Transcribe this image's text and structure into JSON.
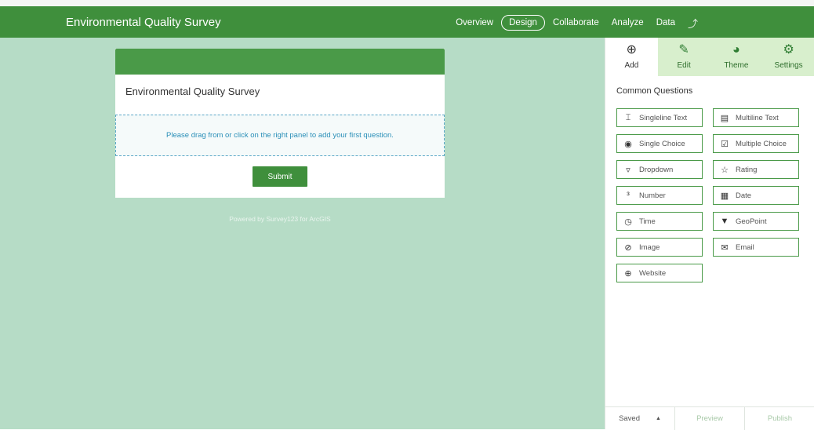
{
  "header": {
    "title": "Environmental Quality Survey",
    "nav": [
      "Overview",
      "Design",
      "Collaborate",
      "Analyze",
      "Data"
    ],
    "active_nav": "Design"
  },
  "form": {
    "title": "Environmental Quality Survey",
    "placeholder": "Please drag from or click on the right panel to add your first question.",
    "submit_label": "Submit",
    "powered_by": "Powered by Survey123 for ArcGIS"
  },
  "panel": {
    "tabs": [
      {
        "label": "Add",
        "icon": "add-circle-icon"
      },
      {
        "label": "Edit",
        "icon": "pencil-icon"
      },
      {
        "label": "Theme",
        "icon": "palette-icon"
      },
      {
        "label": "Settings",
        "icon": "settings-icon"
      }
    ],
    "section_title": "Common Questions",
    "questions": [
      {
        "label": "Singleline Text",
        "icon": "text-cursor-icon"
      },
      {
        "label": "Multiline Text",
        "icon": "text-area-icon"
      },
      {
        "label": "Single Choice",
        "icon": "radio-icon"
      },
      {
        "label": "Multiple Choice",
        "icon": "checkbox-icon"
      },
      {
        "label": "Dropdown",
        "icon": "dropdown-icon"
      },
      {
        "label": "Rating",
        "icon": "star-icon"
      },
      {
        "label": "Number",
        "icon": "number-icon"
      },
      {
        "label": "Date",
        "icon": "calendar-icon"
      },
      {
        "label": "Time",
        "icon": "clock-icon"
      },
      {
        "label": "GeoPoint",
        "icon": "map-pin-icon"
      },
      {
        "label": "Image",
        "icon": "paperclip-icon"
      },
      {
        "label": "Email",
        "icon": "envelope-icon"
      },
      {
        "label": "Website",
        "icon": "globe-icon"
      }
    ],
    "footer": {
      "saved": "Saved",
      "preview": "Preview",
      "publish": "Publish"
    }
  },
  "colors": {
    "brand_green": "#3f8f3c",
    "canvas_bg": "#b6dcc6",
    "tab_bg": "#d8efcd",
    "link_blue": "#2a8fb8"
  }
}
